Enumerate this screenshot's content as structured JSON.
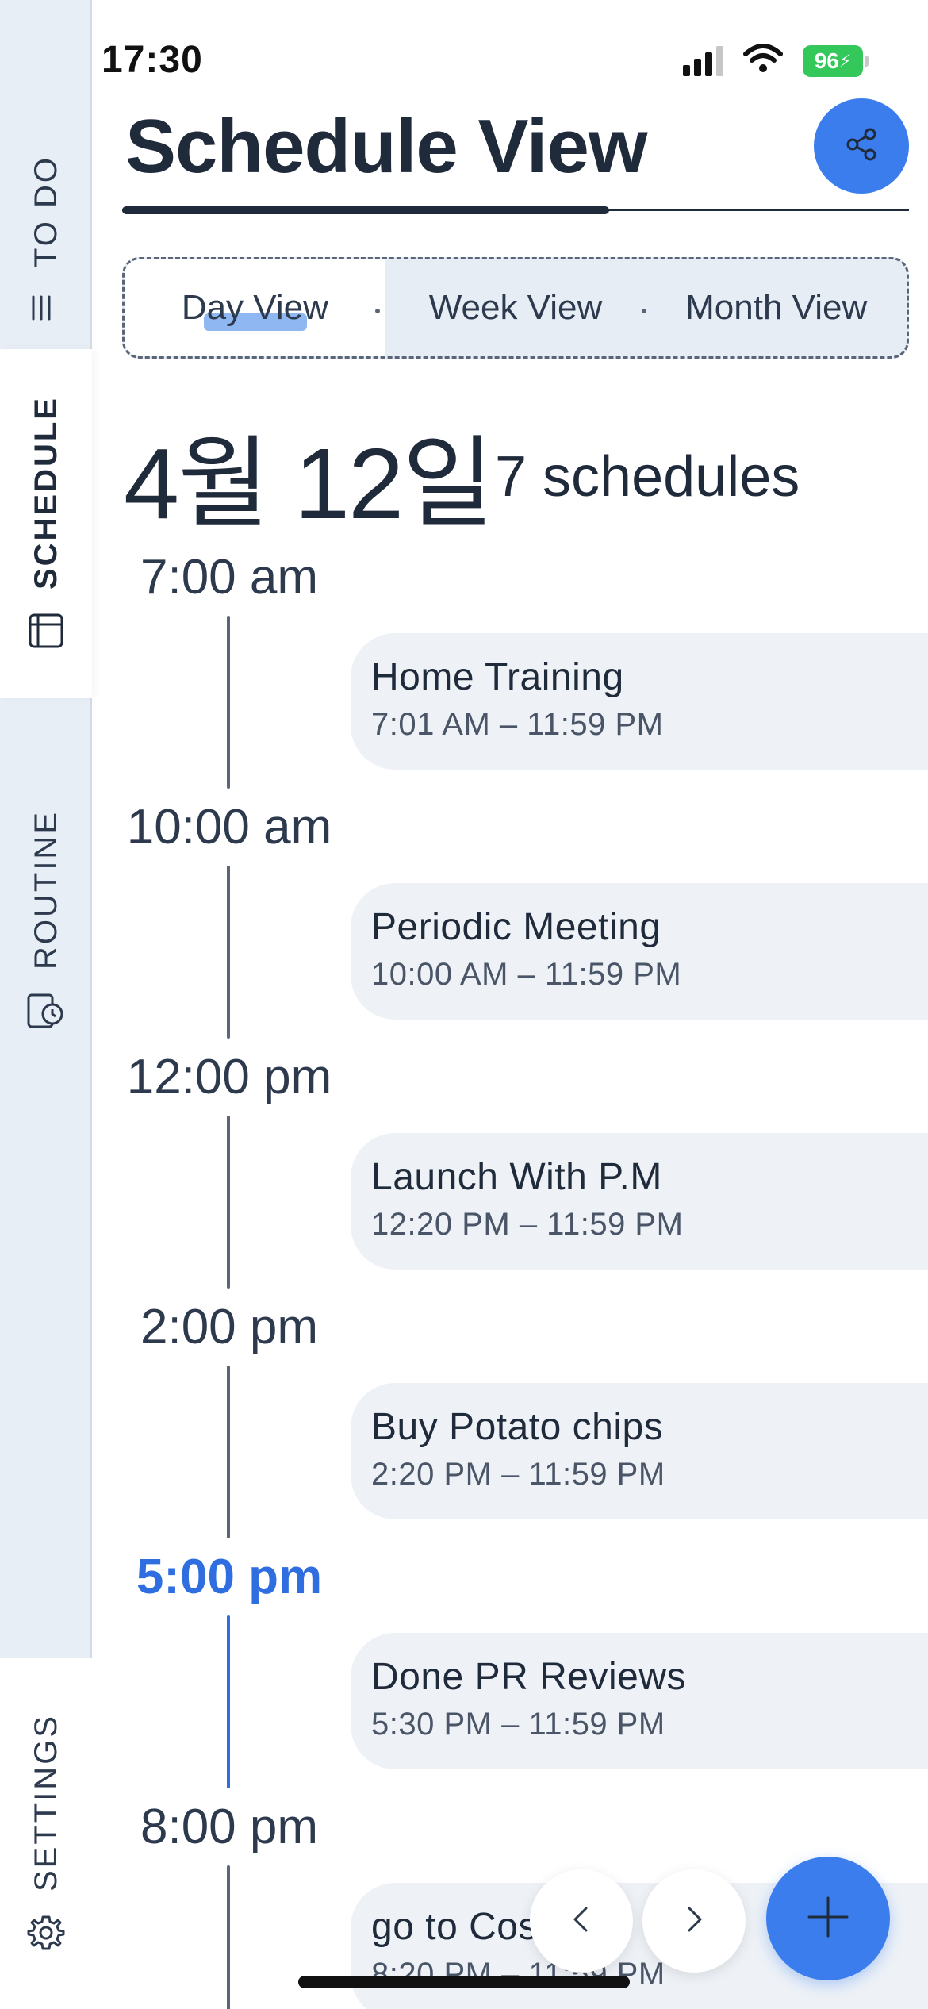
{
  "status_bar": {
    "time": "17:30",
    "battery": "96"
  },
  "sidebar": {
    "todo_label": "TO DO",
    "schedule_label": "SCHEDULE",
    "routine_label": "ROUTINE",
    "settings_label": "SETTINGS",
    "active": "SCHEDULE"
  },
  "header": {
    "title": "Schedule View"
  },
  "view_switch": {
    "tabs": [
      "Day View",
      "Week View",
      "Month View"
    ],
    "active": "Day View"
  },
  "date_header": {
    "date": "4월 12일",
    "count": "7 schedules"
  },
  "timeline": {
    "current_time_label": "5:00 pm",
    "slots": [
      {
        "time": "7:00 am",
        "event": {
          "title": "Home Training",
          "range": "7:01 AM – 11:59 PM"
        }
      },
      {
        "time": "10:00 am",
        "event": {
          "title": "Periodic Meeting",
          "range": "10:00 AM – 11:59 PM"
        }
      },
      {
        "time": "12:00 pm",
        "event": {
          "title": "Launch With P.M",
          "range": "12:20 PM – 11:59 PM"
        }
      },
      {
        "time": "2:00 pm",
        "event": {
          "title": "Buy Potato chips",
          "range": "2:20 PM – 11:59 PM"
        }
      },
      {
        "time": "5:00 pm",
        "event": {
          "title": "Done PR Reviews",
          "range": "5:30 PM – 11:59 PM"
        }
      },
      {
        "time": "8:00 pm",
        "event": {
          "title": "go to Costco",
          "range": "8:20 PM – 11:59 PM"
        }
      }
    ]
  },
  "colors": {
    "accent": "#3b7ded",
    "current_time": "#2f6ee0",
    "sidebar_bg": "#e8eef5",
    "card_bg": "#eef2f7"
  }
}
